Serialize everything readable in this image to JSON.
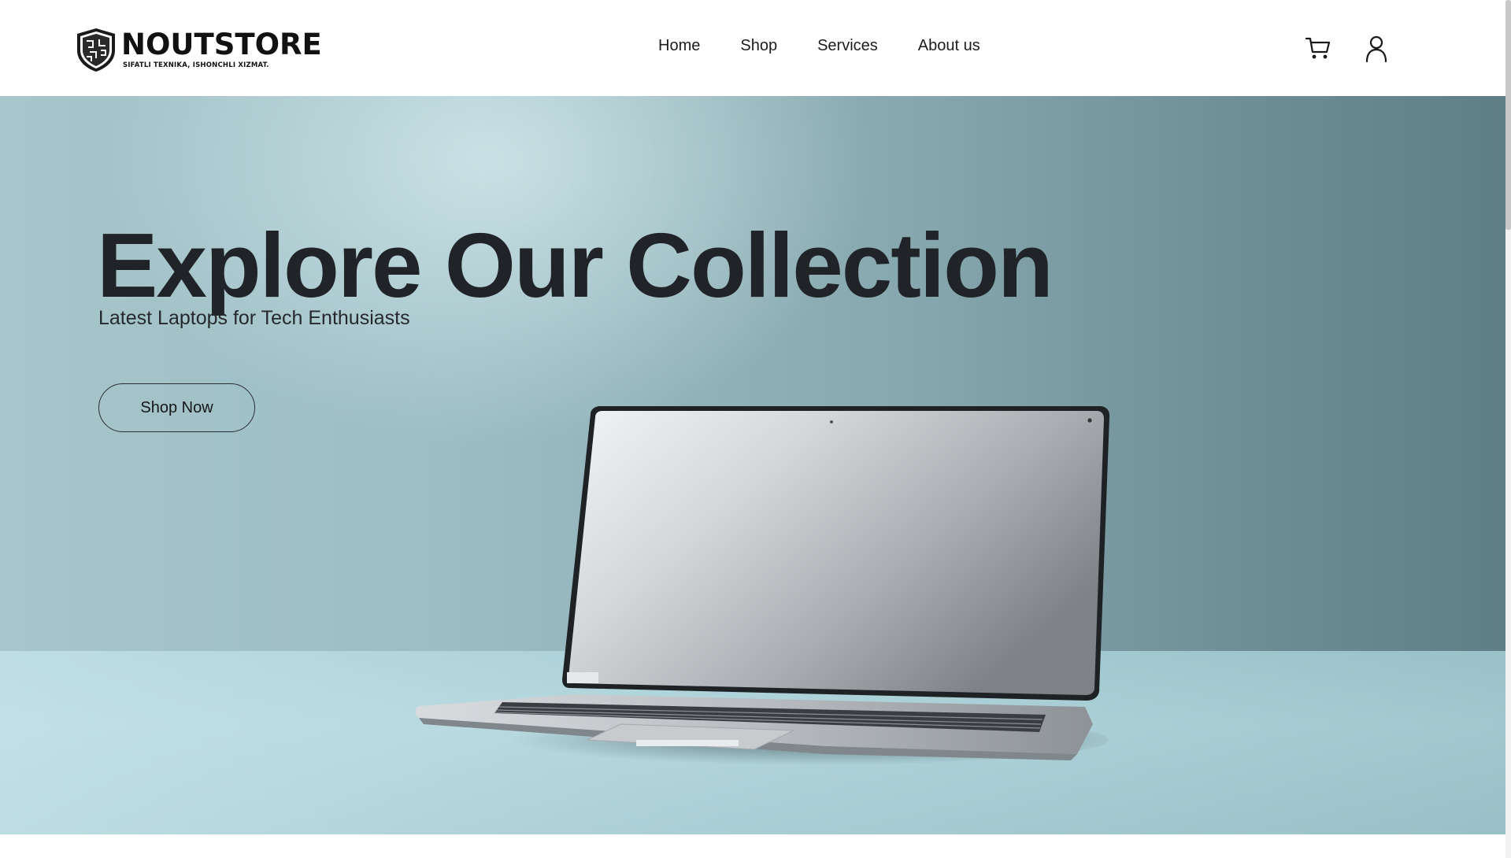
{
  "brand": {
    "name": "NOUTSTORE",
    "tagline": "SIFATLI TEXNIKA, ISHONCHLI XIZMAT."
  },
  "nav": {
    "items": [
      {
        "label": "Home"
      },
      {
        "label": "Shop"
      },
      {
        "label": "Services"
      },
      {
        "label": "About us"
      }
    ]
  },
  "header_icons": {
    "cart": "cart-icon",
    "user": "user-icon"
  },
  "hero": {
    "title": "Explore Our Collection",
    "subtitle": "Latest Laptops for Tech Enthusiasts",
    "cta_label": "Shop Now",
    "image": "laptop-image"
  },
  "colors": {
    "background": "#ffffff",
    "text": "#222428",
    "hero_bg": "#8fb2b8"
  }
}
